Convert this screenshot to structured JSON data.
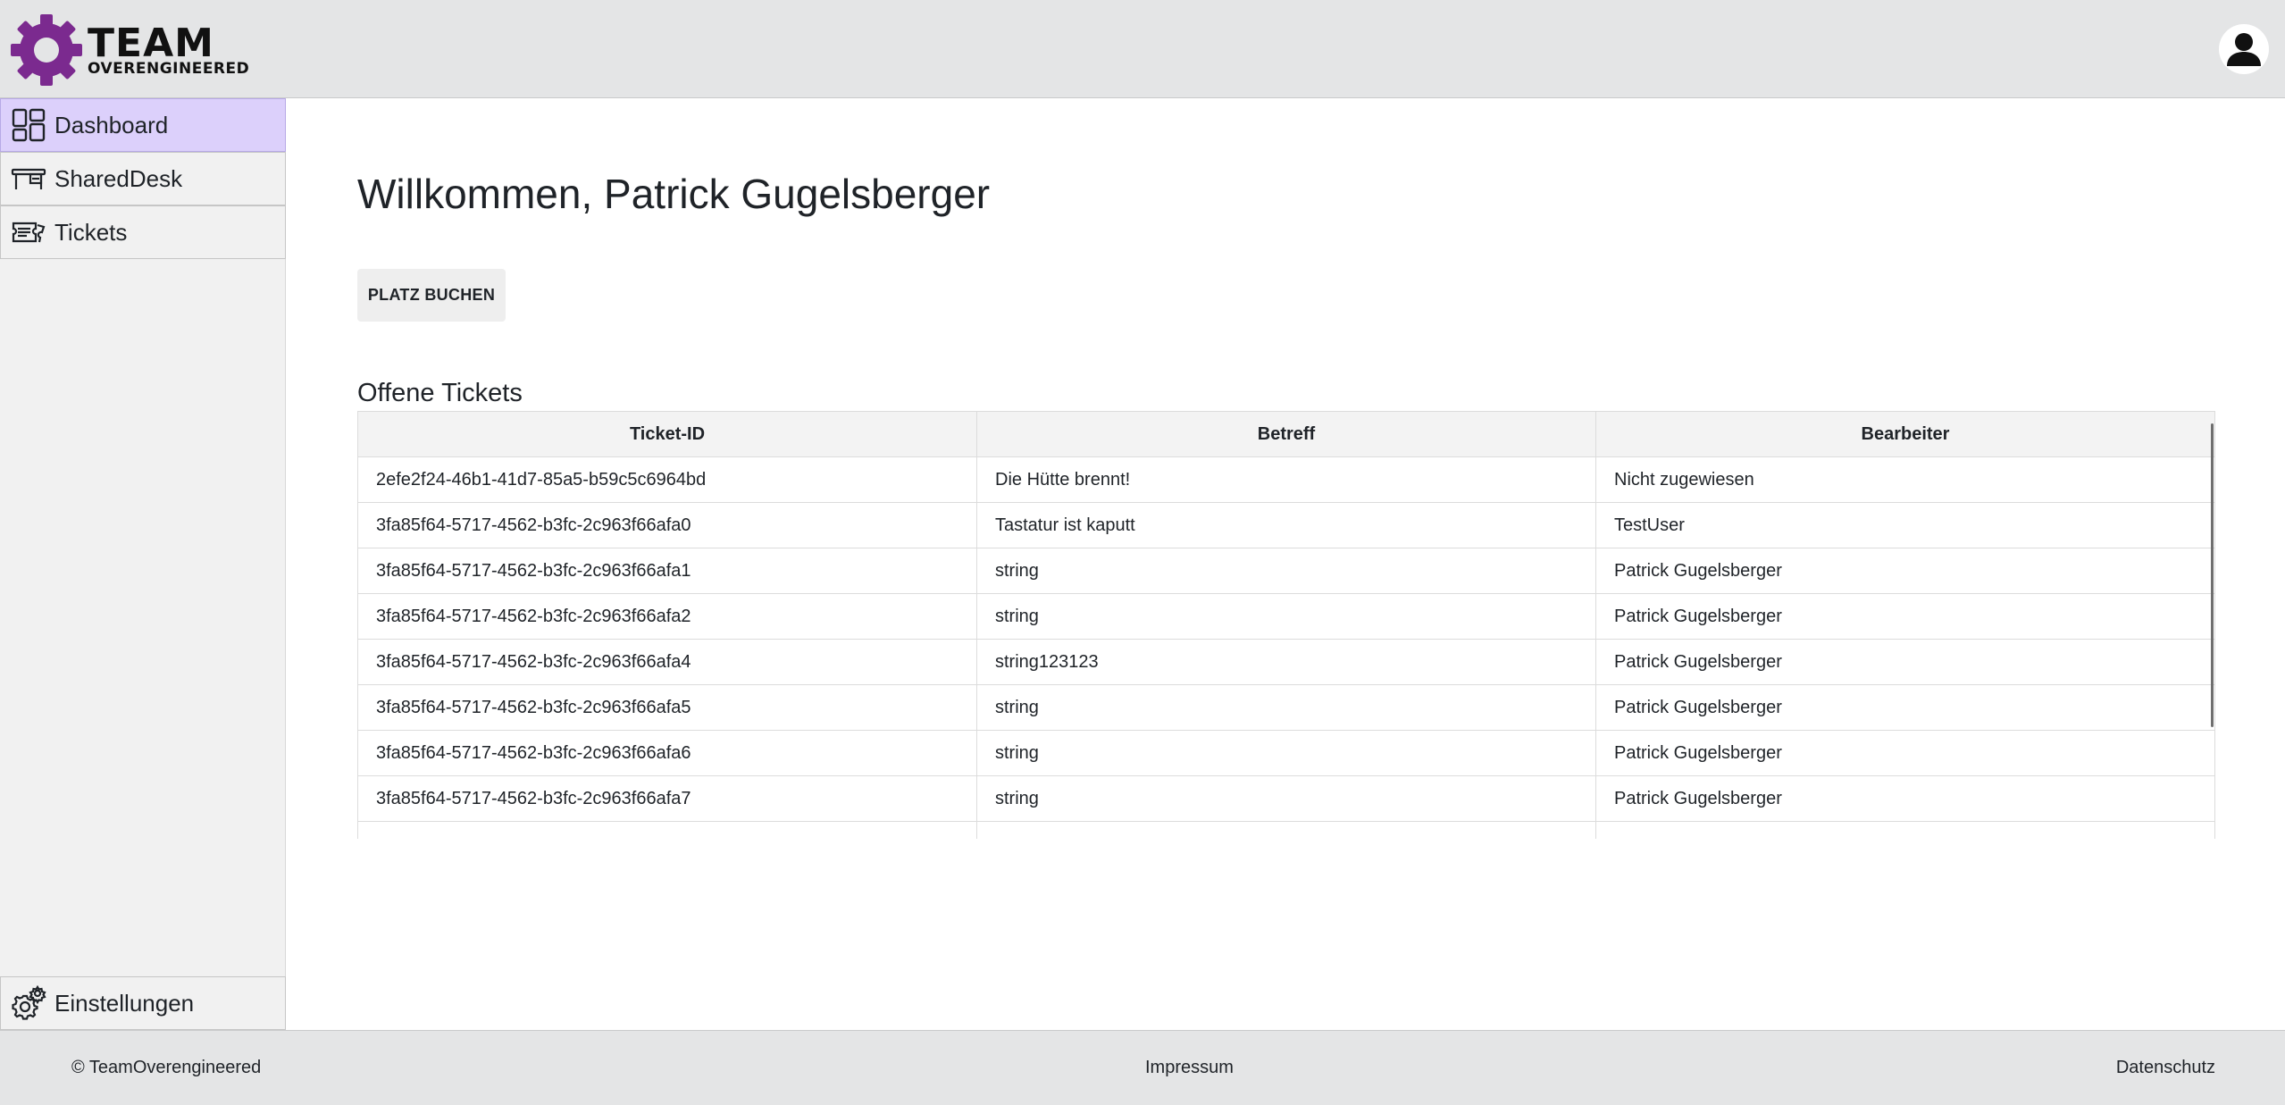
{
  "brand": {
    "line1": "TEAM",
    "line2": "OVERENGINEERED",
    "color": "#7b2a8f"
  },
  "sidebar": {
    "items": [
      {
        "label": "Dashboard",
        "icon": "dashboard-icon",
        "active": true
      },
      {
        "label": "SharedDesk",
        "icon": "desk-icon",
        "active": false
      },
      {
        "label": "Tickets",
        "icon": "ticket-icon",
        "active": false
      }
    ],
    "settings_label": "Einstellungen",
    "active_color": "#dcd0fb"
  },
  "main": {
    "welcome": "Willkommen, Patrick Gugelsberger",
    "book_button": "PLATZ BUCHEN",
    "section_title": "Offene Tickets",
    "table": {
      "headers": [
        "Ticket-ID",
        "Betreff",
        "Bearbeiter"
      ],
      "rows": [
        [
          "2efe2f24-46b1-41d7-85a5-b59c5c6964bd",
          "Die Hütte brennt!",
          "Nicht zugewiesen"
        ],
        [
          "3fa85f64-5717-4562-b3fc-2c963f66afa0",
          "Tastatur ist kaputt",
          "TestUser"
        ],
        [
          "3fa85f64-5717-4562-b3fc-2c963f66afa1",
          "string",
          "Patrick Gugelsberger"
        ],
        [
          "3fa85f64-5717-4562-b3fc-2c963f66afa2",
          "string",
          "Patrick Gugelsberger"
        ],
        [
          "3fa85f64-5717-4562-b3fc-2c963f66afa4",
          "string123123",
          "Patrick Gugelsberger"
        ],
        [
          "3fa85f64-5717-4562-b3fc-2c963f66afa5",
          "string",
          "Patrick Gugelsberger"
        ],
        [
          "3fa85f64-5717-4562-b3fc-2c963f66afa6",
          "string",
          "Patrick Gugelsberger"
        ],
        [
          "3fa85f64-5717-4562-b3fc-2c963f66afa7",
          "string",
          "Patrick Gugelsberger"
        ]
      ]
    }
  },
  "footer": {
    "copyright": "© TeamOverengineered",
    "impressum": "Impressum",
    "datenschutz": "Datenschutz"
  }
}
